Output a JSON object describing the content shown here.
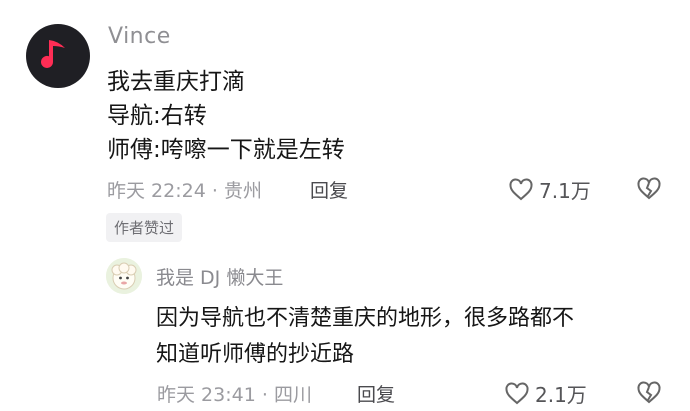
{
  "comment": {
    "username": "Vince",
    "lines": [
      "我去重庆打滴",
      "导航:右转",
      "师傅:咵嚓一下就是左转"
    ],
    "time": "昨天 22:24",
    "location": "贵州",
    "reply_label": "回复",
    "likes": "7.1万",
    "author_badge": "作者赞过",
    "avatar_icon": "music-note-icon"
  },
  "reply": {
    "username": "我是 DJ 懒大王",
    "lines": [
      "因为导航也不清楚重庆的地形，很多路都不",
      "知道听师傅的抄近路"
    ],
    "time": "昨天 23:41",
    "location": "四川",
    "reply_label": "回复",
    "likes": "2.1万",
    "avatar_icon": "sheep-cartoon-icon"
  },
  "colors": {
    "music_red": "#ff2d55",
    "text": "#161616",
    "meta": "#9b9ba0"
  }
}
